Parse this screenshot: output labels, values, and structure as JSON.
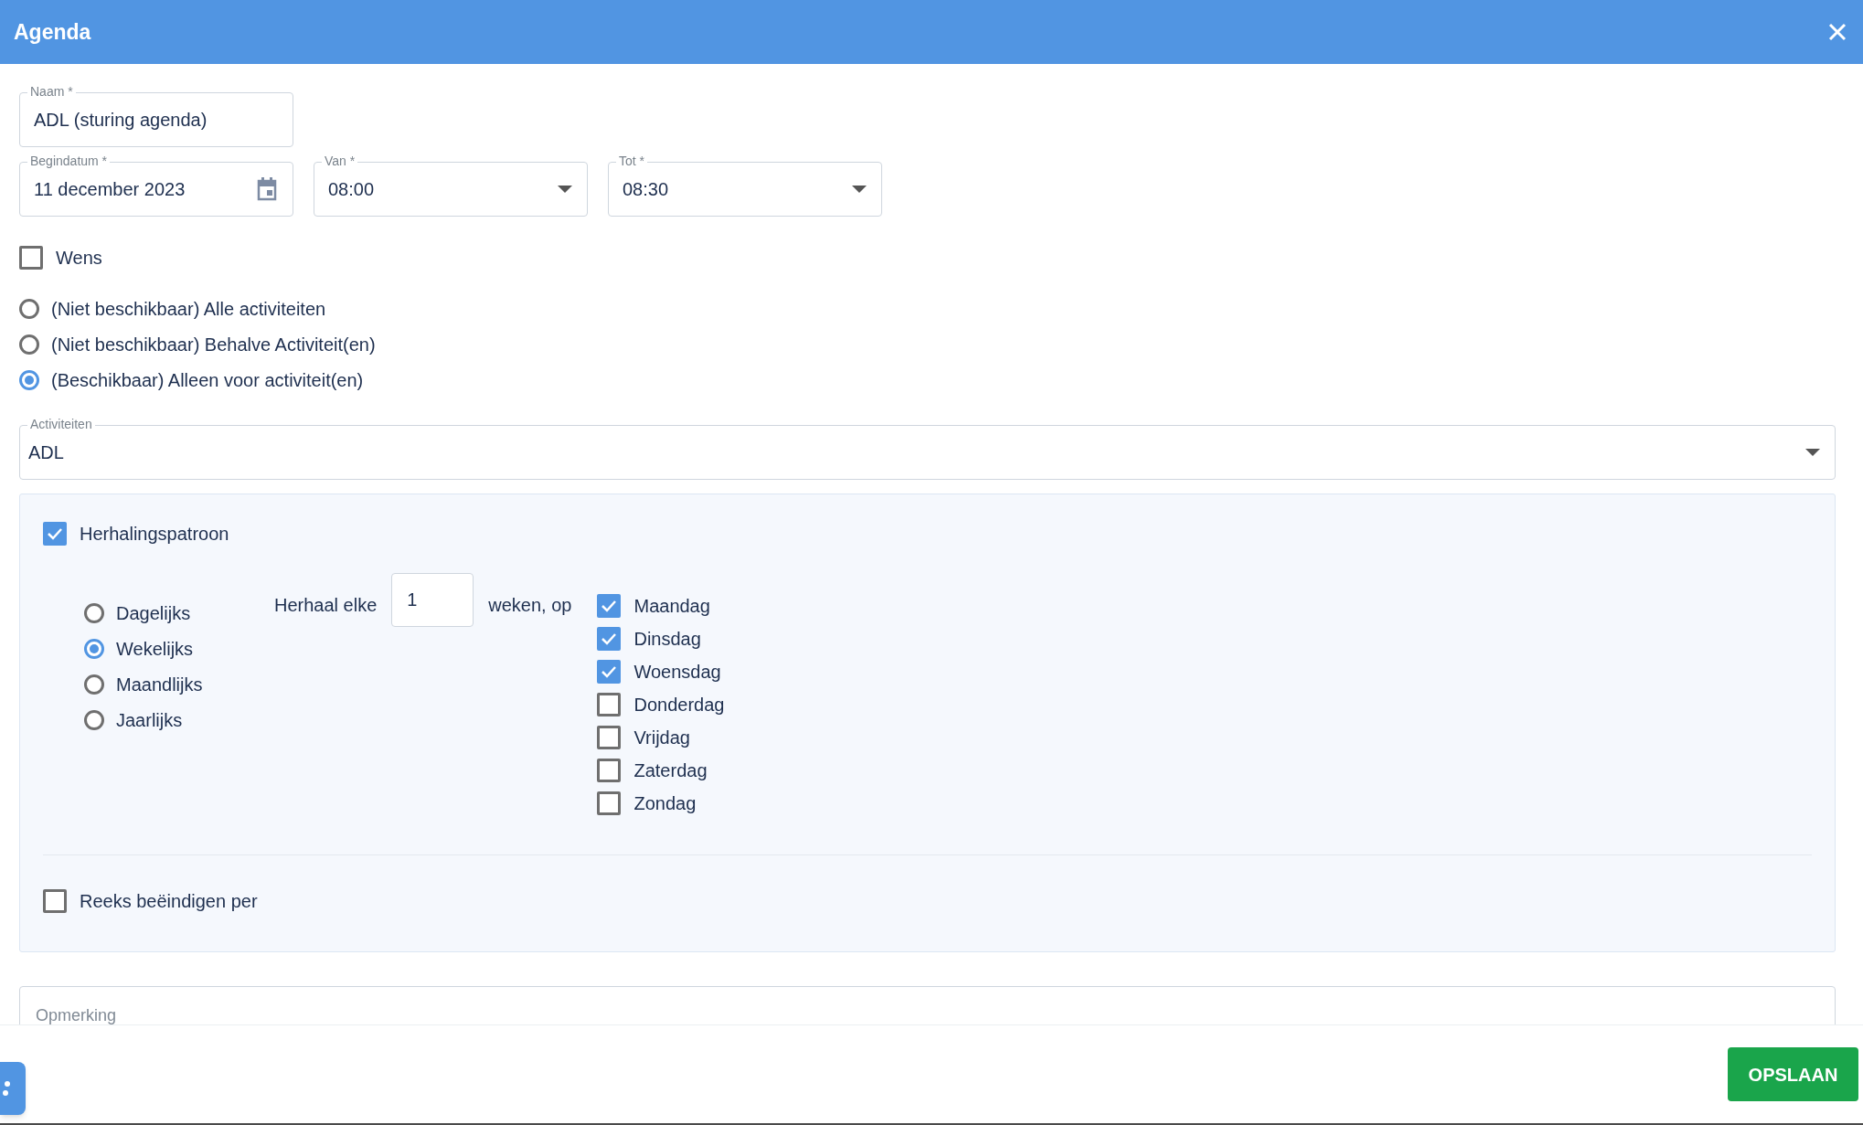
{
  "window": {
    "title": "Agenda"
  },
  "fields": {
    "naam": {
      "label": "Naam *",
      "value": "ADL (sturing agenda)"
    },
    "begindatum": {
      "label": "Begindatum *",
      "value": "11 december 2023"
    },
    "van": {
      "label": "Van *",
      "value": "08:00"
    },
    "tot": {
      "label": "Tot *",
      "value": "08:30"
    }
  },
  "wens": {
    "label": "Wens",
    "checked": false
  },
  "availability": [
    {
      "label": "(Niet beschikbaar) Alle activiteiten",
      "selected": false
    },
    {
      "label": "(Niet beschikbaar) Behalve Activiteit(en)",
      "selected": false
    },
    {
      "label": "(Beschikbaar) Alleen voor activiteit(en)",
      "selected": true
    }
  ],
  "activiteiten": {
    "label": "Activiteiten",
    "value": "ADL"
  },
  "recurrence": {
    "label": "Herhalingspatroon",
    "checked": true,
    "frequencies": [
      {
        "label": "Dagelijks",
        "selected": false
      },
      {
        "label": "Wekelijks",
        "selected": true
      },
      {
        "label": "Maandlijks",
        "selected": false
      },
      {
        "label": "Jaarlijks",
        "selected": false
      }
    ],
    "repeat_label": "Herhaal elke",
    "interval": "1",
    "unit_label": "weken, op",
    "days": [
      {
        "label": "Maandag",
        "checked": true
      },
      {
        "label": "Dinsdag",
        "checked": true
      },
      {
        "label": "Woensdag",
        "checked": true
      },
      {
        "label": "Donderdag",
        "checked": false
      },
      {
        "label": "Vrijdag",
        "checked": false
      },
      {
        "label": "Zaterdag",
        "checked": false
      },
      {
        "label": "Zondag",
        "checked": false
      }
    ],
    "end": {
      "label": "Reeks beëindigen per",
      "checked": false
    }
  },
  "opmerking": {
    "placeholder": "Opmerking"
  },
  "save_button": "OPSLAAN"
}
